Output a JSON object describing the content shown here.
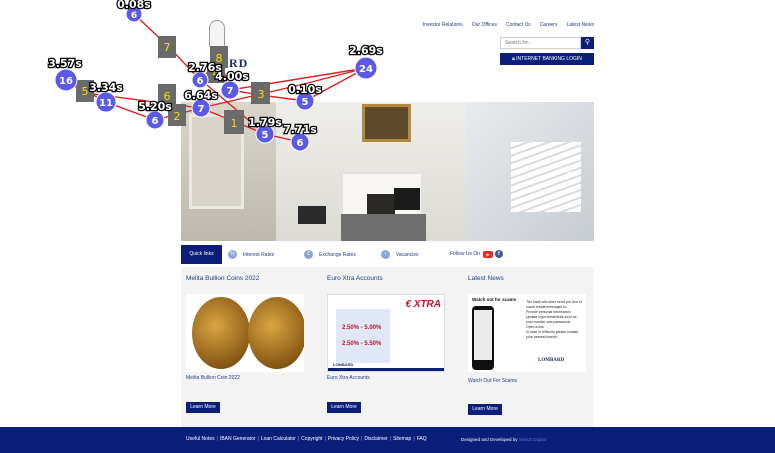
{
  "header": {
    "logo_word": "RD",
    "nav": [
      "Investor Relations",
      "Our Offices",
      "Contact Us",
      "Careers",
      "Latest News"
    ],
    "search_placeholder": "Search for...",
    "search_icon": "search-icon",
    "ib_login_label": "INTERNET BANKING LOGIN",
    "ib_login_icon": "lock-icon"
  },
  "hero": {
    "next_arrow": "›"
  },
  "quicklinks": {
    "tab": "Quick links",
    "items": [
      {
        "label": "Interest Rates",
        "icon": "percent-icon"
      },
      {
        "label": "Exchange Rates",
        "icon": "exchange-icon"
      },
      {
        "label": "Vacancies",
        "icon": "person-icon"
      }
    ],
    "follow": "Follow Us On",
    "youtube_glyph": "▶",
    "facebook_glyph": "f"
  },
  "columns": [
    {
      "title": "Melita Bullion Coins 2022",
      "caption": "Melita Bullion Coin 2022",
      "button": "Learn More"
    },
    {
      "title": "Euro Xtra Accounts",
      "caption": "Euro Xtra Accounts",
      "button": "Learn More"
    },
    {
      "title": "Latest News",
      "caption": "Watch Out For Scams",
      "button": "Learn More"
    }
  ],
  "euro_ad": {
    "xtra": "€ XTRA",
    "rate1": "2.50% - 5.00%",
    "rate2": "2.50% - 5.50%",
    "brand": "LOMBARD"
  },
  "news_ad": {
    "title": "Watch out for scams",
    "lines": [
      "The bank will never send you text or social media messages to:",
      "Provide personal information",
      "Update login credentials such as your number and passwords",
      "Open a link",
      "In case of difficulty please contact your nearest branch."
    ],
    "brand": "LOMBARD"
  },
  "footer": {
    "links": [
      "Useful Notes",
      "IBAN Generator",
      "Loan Calculator",
      "Copyright",
      "Privacy Policy",
      "Disclaimer",
      "Sitemap",
      "FAQ"
    ],
    "credit": "Designed and Developed by",
    "credit_by": "Switch Digital"
  },
  "overlay": {
    "colors": {
      "line": "#e02020",
      "circle": "#5a5ae6",
      "box": "#6a6a6a",
      "box_text": "#f5e000",
      "label": "#ffffff"
    },
    "times": [
      "0.08s",
      "3.57s",
      "3.34s",
      "5.20s",
      "6.64s",
      "2.76s",
      "4.00s",
      "1.79s",
      "7.71s",
      "0.10s",
      "2.69s"
    ],
    "circles": [
      "6",
      "16",
      "11",
      "6",
      "7",
      "6",
      "7",
      "5",
      "6",
      "5",
      "24"
    ],
    "boxes": [
      "7",
      "8",
      "4",
      "3",
      "6",
      "5",
      "2",
      "1"
    ]
  }
}
